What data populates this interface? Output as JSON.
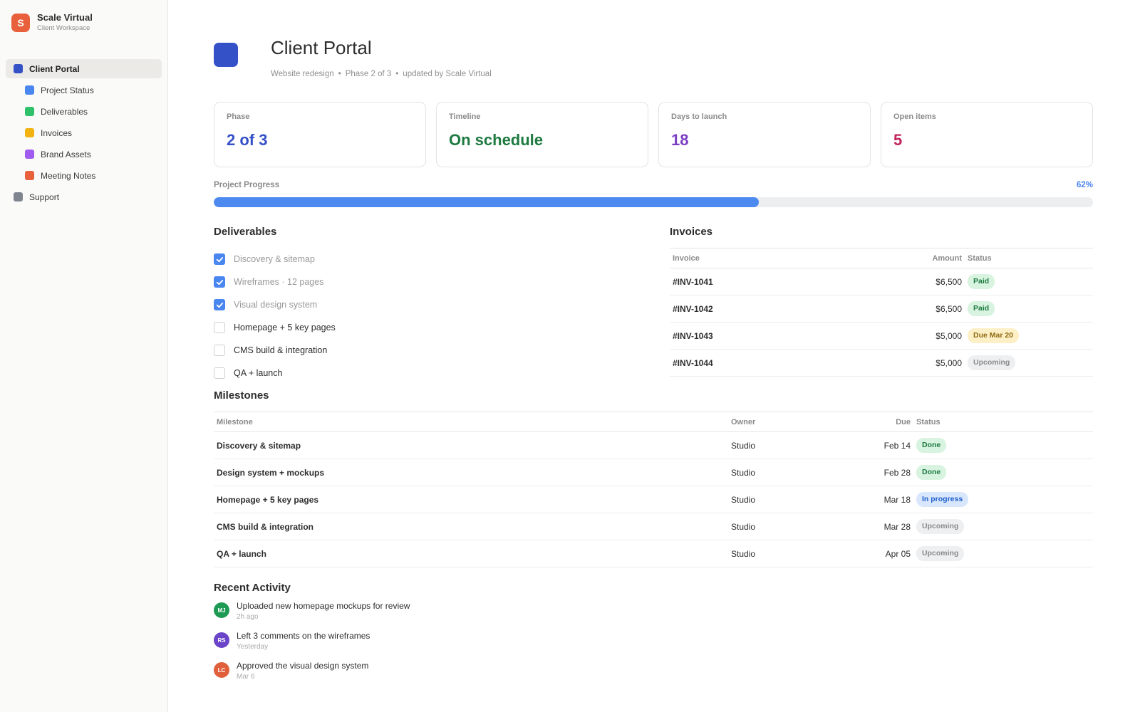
{
  "brand": {
    "logo_letter": "S",
    "name": "Scale Virtual",
    "subtitle": "Client Workspace",
    "color": "#e8613c"
  },
  "sidebar": {
    "items": [
      {
        "label": "Client Portal",
        "color": "#3551c8",
        "active": true,
        "child": false
      },
      {
        "label": "Project Status",
        "color": "#4a86f0",
        "active": false,
        "child": true
      },
      {
        "label": "Deliverables",
        "color": "#2ec16a",
        "active": false,
        "child": true
      },
      {
        "label": "Invoices",
        "color": "#f2b311",
        "active": false,
        "child": true
      },
      {
        "label": "Brand Assets",
        "color": "#a05bf0",
        "active": false,
        "child": true
      },
      {
        "label": "Meeting Notes",
        "color": "#e8613c",
        "active": false,
        "child": true
      },
      {
        "label": "Support",
        "color": "#7e8490",
        "active": false,
        "child": false
      }
    ]
  },
  "header": {
    "title": "Client Portal",
    "meta": [
      "Website redesign",
      "Phase 2 of 3",
      "updated by Scale Virtual"
    ],
    "separator": "•",
    "icon_color": "#3551c8"
  },
  "stats": [
    {
      "label": "Phase",
      "value": "2 of 3",
      "color": "#3551c8"
    },
    {
      "label": "Timeline",
      "value": "On schedule",
      "color": "#1d7a40"
    },
    {
      "label": "Days to launch",
      "value": "18",
      "color": "#7b3fc4"
    },
    {
      "label": "Open items",
      "value": "5",
      "color": "#c2255c"
    }
  ],
  "progress": {
    "label": "Project Progress",
    "percent_text": "62%",
    "fraction": 0.62
  },
  "deliverables": {
    "title": "Deliverables",
    "items": [
      {
        "label": "Discovery & sitemap",
        "done": true
      },
      {
        "label": "Wireframes · 12 pages",
        "done": true
      },
      {
        "label": "Visual design system",
        "done": true
      },
      {
        "label": "Homepage + 5 key pages",
        "done": false
      },
      {
        "label": "CMS build & integration",
        "done": false
      },
      {
        "label": "QA + launch",
        "done": false
      }
    ]
  },
  "invoices": {
    "title": "Invoices",
    "columns": [
      "Invoice",
      "Amount",
      "Status"
    ],
    "rows": [
      {
        "id": "#INV-1041",
        "amount": "$6,500",
        "status": "Paid",
        "tone": "green"
      },
      {
        "id": "#INV-1042",
        "amount": "$6,500",
        "status": "Paid",
        "tone": "green"
      },
      {
        "id": "#INV-1043",
        "amount": "$5,000",
        "status": "Due Mar 20",
        "tone": "yellow"
      },
      {
        "id": "#INV-1044",
        "amount": "$5,000",
        "status": "Upcoming",
        "tone": "gray"
      }
    ]
  },
  "milestones": {
    "title": "Milestones",
    "columns": [
      "Milestone",
      "Owner",
      "Due",
      "Status"
    ],
    "rows": [
      {
        "name": "Discovery & sitemap",
        "owner": "Studio",
        "due": "Feb 14",
        "status": "Done",
        "tone": "green"
      },
      {
        "name": "Design system + mockups",
        "owner": "Studio",
        "due": "Feb 28",
        "status": "Done",
        "tone": "green"
      },
      {
        "name": "Homepage + 5 key pages",
        "owner": "Studio",
        "due": "Mar 18",
        "status": "In progress",
        "tone": "blue"
      },
      {
        "name": "CMS build & integration",
        "owner": "Studio",
        "due": "Mar 28",
        "status": "Upcoming",
        "tone": "gray"
      },
      {
        "name": "QA + launch",
        "owner": "Studio",
        "due": "Apr 05",
        "status": "Upcoming",
        "tone": "gray"
      }
    ]
  },
  "activity": {
    "title": "Recent Activity",
    "items": [
      {
        "initials": "MJ",
        "color": "#1f9a55",
        "text": "Uploaded new homepage mockups for review",
        "time": "2h ago"
      },
      {
        "initials": "RS",
        "color": "#6a45c9",
        "text": "Left 3 comments on the wireframes",
        "time": "Yesterday"
      },
      {
        "initials": "LC",
        "color": "#e0603b",
        "text": "Approved the visual design system",
        "time": "Mar 6"
      }
    ]
  }
}
